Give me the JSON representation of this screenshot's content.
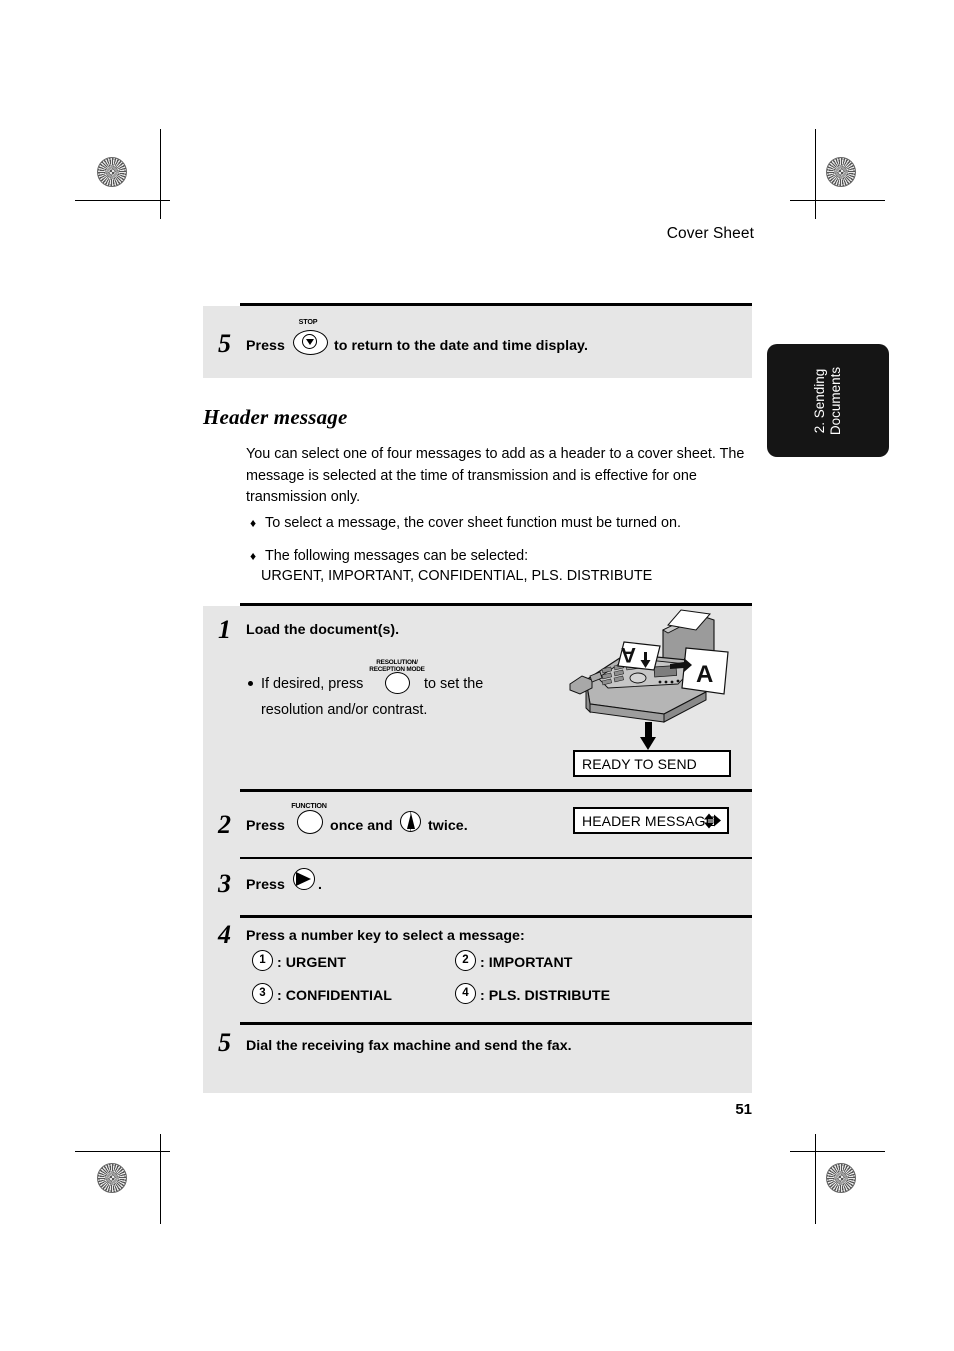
{
  "page": {
    "running_head": "Cover Sheet",
    "page_number": "51",
    "thumb_tab": "2. Sending\nDocuments",
    "thumb_tab_line1": "2. Sending",
    "thumb_tab_line2": "Documents"
  },
  "top_step": {
    "number": "5",
    "press_label": "Press",
    "key_label": "STOP",
    "key_name": "stop-key",
    "text_after": "to return to the date and time display."
  },
  "section": {
    "heading": "Header message",
    "intro": "You can select one of four messages to add as a header to a cover sheet. The message is selected at the time of transmission and is effective for one transmission only.",
    "bullets": [
      "To select a message, the cover sheet function must be turned on.",
      "The following messages can be selected:\nURGENT, IMPORTANT, CONFIDENTIAL, PLS. DISTRIBUTE"
    ],
    "bullet_1": "To select a message, the cover sheet function must be turned on.",
    "bullet_2_line1": "The following messages can be selected:",
    "bullet_2_line2": "URGENT, IMPORTANT, CONFIDENTIAL, PLS. DISTRIBUTE",
    "bullet_glyph": "♦"
  },
  "steps": {
    "step1": {
      "number": "1",
      "title": "Load the document(s).",
      "sub_pre": "If desired, press",
      "sub_post": "to set the",
      "sub_line2": "resolution and/or contrast.",
      "key_label_line1": "RESOLUTION/",
      "key_label_line2": "RECEPTION MODE",
      "display": "READY TO SEND"
    },
    "step2": {
      "number": "2",
      "press_label": "Press",
      "key_label": "FUNCTION",
      "mid_text": "once and",
      "end_text": "twice.",
      "display": "HEADER MESSAGE"
    },
    "step3": {
      "number": "3",
      "press_label": "Press",
      "trailing": "."
    },
    "step4": {
      "number": "4",
      "title": "Press a number key to select a message:",
      "options": [
        {
          "key": "1",
          "label": ": URGENT"
        },
        {
          "key": "2",
          "label": ": IMPORTANT"
        },
        {
          "key": "3",
          "label": ": CONFIDENTIAL"
        },
        {
          "key": "4",
          "label": ": PLS. DISTRIBUTE"
        }
      ]
    },
    "step5": {
      "number": "5",
      "title": "Dial the receiving fax machine and send the fax."
    }
  },
  "colors": {
    "panel_background": "#e6e6e6",
    "tab_background": "#151515",
    "rule": "#000000",
    "page_background": "#ffffff"
  }
}
